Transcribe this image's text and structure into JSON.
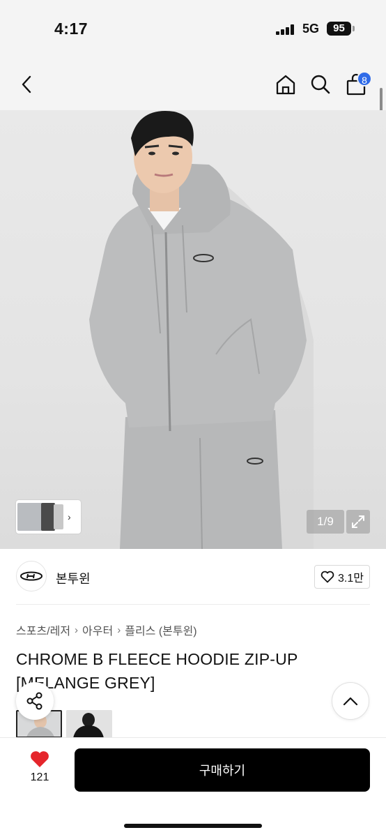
{
  "status_bar": {
    "time": "4:17",
    "network": "5G",
    "battery": "95"
  },
  "nav": {
    "cart_count": "8"
  },
  "gallery": {
    "counter": "1/9"
  },
  "brand": {
    "name": "본투윈",
    "likes": "3.1만"
  },
  "breadcrumb": {
    "items": [
      "스포츠/레저",
      "아우터",
      "플리스 (본투윈)"
    ]
  },
  "product": {
    "title": "CHROME B FLEECE HOODIE ZIP-UP [MELANGE GREY]"
  },
  "bottom_bar": {
    "wish_count": "121",
    "buy_label": "구매하기"
  },
  "icons": {
    "back": "chevron-left-icon",
    "home": "home-icon",
    "search": "search-icon",
    "cart": "shopping-bag-icon",
    "expand": "expand-icon",
    "heart_outline": "heart-outline-icon",
    "heart_filled": "heart-filled-icon",
    "share": "share-icon",
    "scroll_top": "chevron-up-icon"
  },
  "colors": {
    "accent": "#2f6be8",
    "wish_heart": "#e5252b",
    "buy_button": "#000000"
  }
}
